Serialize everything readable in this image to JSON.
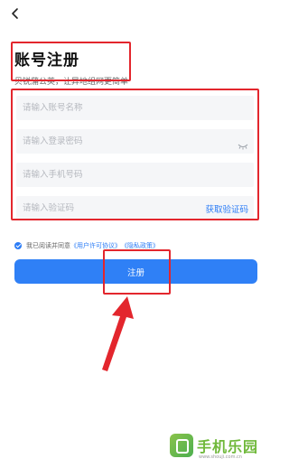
{
  "header": {
    "back_icon": "chevron-left-icon"
  },
  "title_block": {
    "title": "账号注册",
    "subtitle": "贝锐蒲公英，让异地组网更简单"
  },
  "form": {
    "account_placeholder": "请输入账号名称",
    "password_placeholder": "请输入登录密码",
    "phone_placeholder": "请输入手机号码",
    "code_placeholder": "请输入验证码",
    "get_code_label": "获取验证码",
    "password_toggle_icon": "eye-closed-icon"
  },
  "agreement": {
    "prefix": "我已阅读并同意",
    "user_agreement": "《用户许可协议》",
    "privacy_policy": "《隐私政策》"
  },
  "register_button": {
    "label": "注册"
  },
  "watermark": {
    "title": "手机乐园",
    "url": "www.shouji.com.cn"
  },
  "colors": {
    "accent": "#2f80f6",
    "highlight": "#e3262d",
    "field_bg": "#f5f6f8"
  }
}
